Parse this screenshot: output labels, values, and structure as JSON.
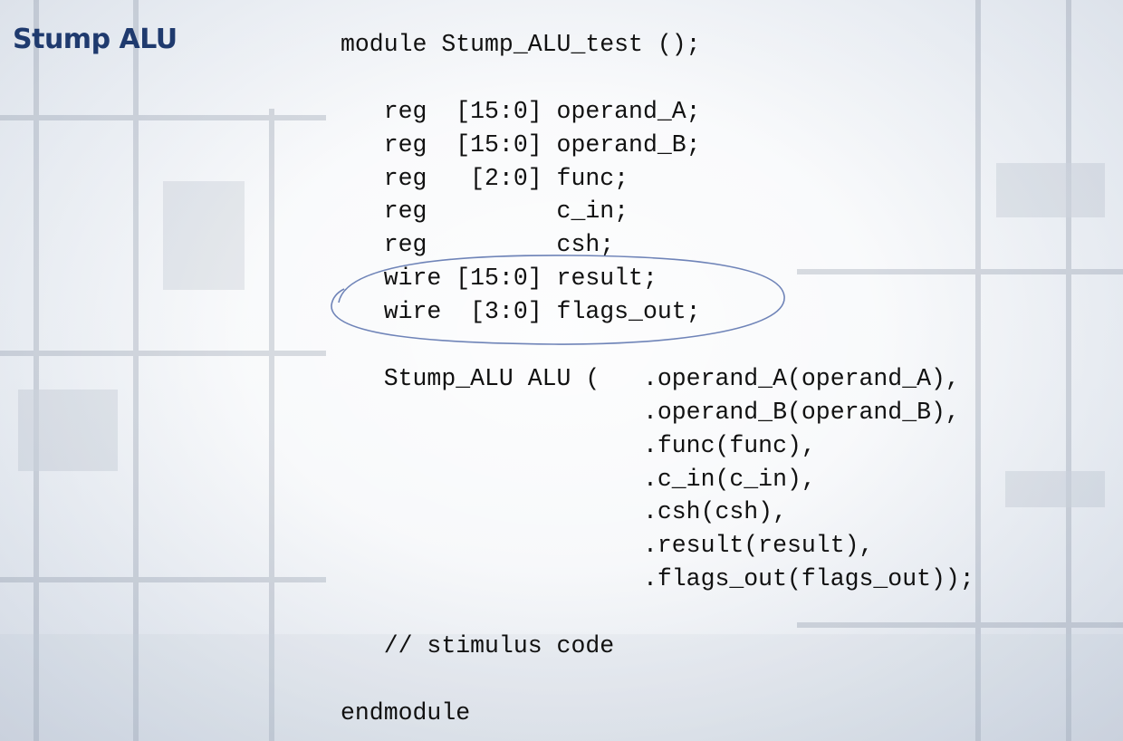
{
  "slide": {
    "title": "Stump ALU"
  },
  "code": {
    "lines": [
      "module Stump_ALU_test ();",
      "",
      "   reg  [15:0] operand_A;",
      "   reg  [15:0] operand_B;",
      "   reg   [2:0] func;",
      "   reg         c_in;",
      "   reg         csh;",
      "   wire [15:0] result;",
      "   wire  [3:0] flags_out;",
      "",
      "   Stump_ALU ALU (   .operand_A(operand_A),",
      "                     .operand_B(operand_B),",
      "                     .func(func),",
      "                     .c_in(c_in),",
      "                     .csh(csh),",
      "                     .result(result),",
      "                     .flags_out(flags_out));",
      "",
      "   // stimulus code",
      "",
      "endmodule"
    ]
  },
  "annotation": {
    "shape": "ellipse",
    "color": "#6f84b8",
    "highlights": "wire declarations (result, flags_out)"
  },
  "colors": {
    "title": "#1f3a6e",
    "code_text": "#111111",
    "background": "#e4e9f0"
  }
}
